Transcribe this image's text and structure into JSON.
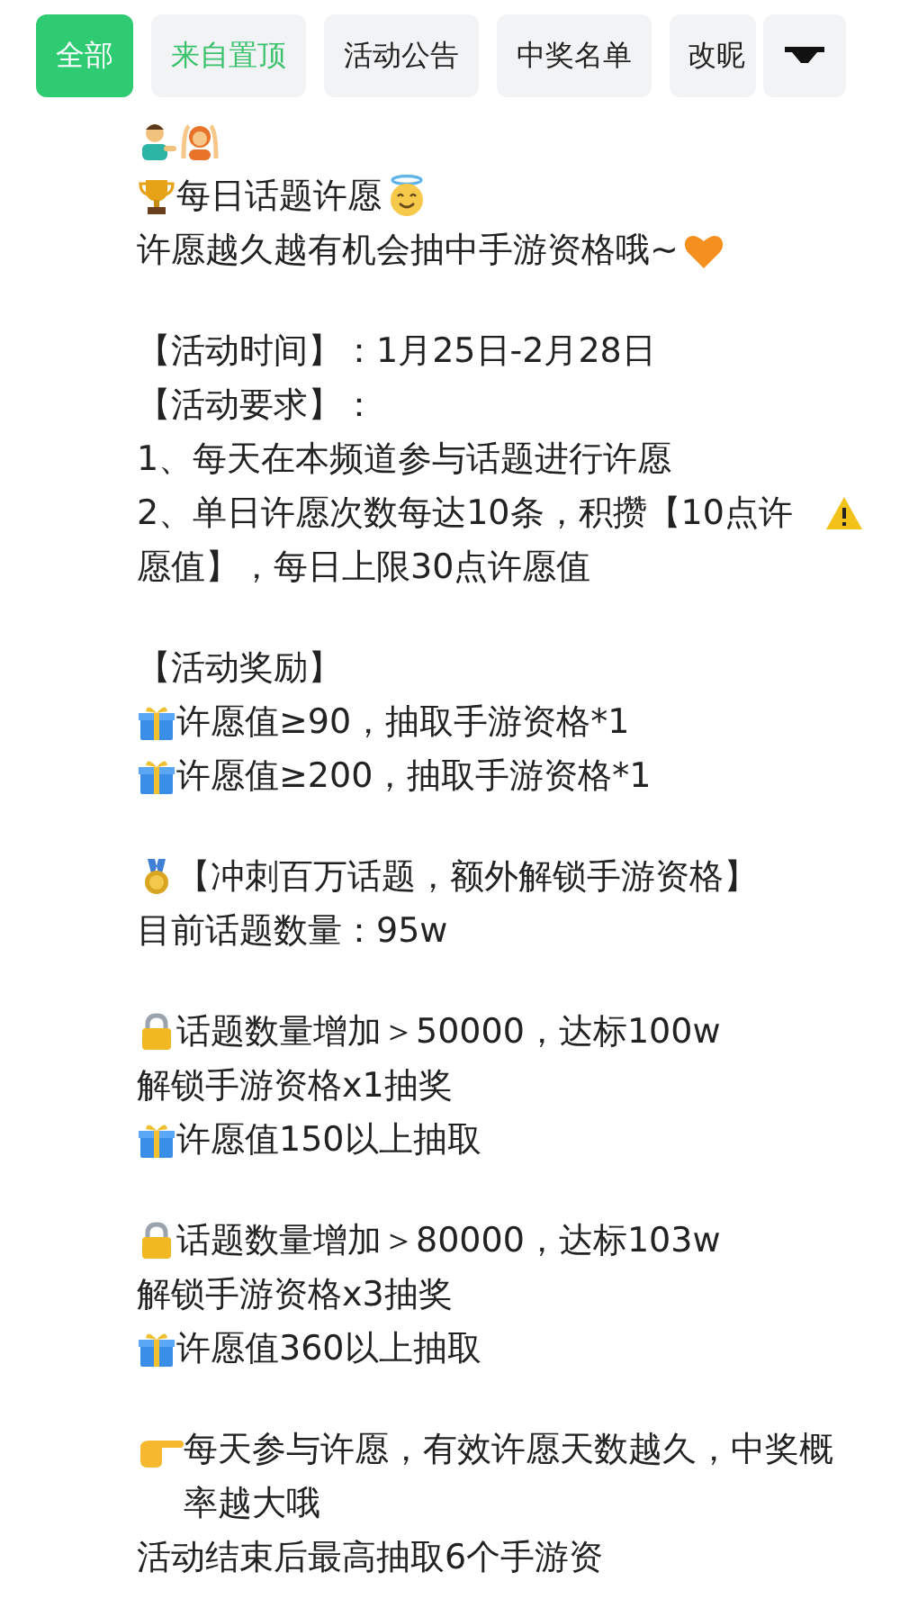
{
  "tabs": [
    {
      "label": "全部",
      "selected": true,
      "kind": "plain"
    },
    {
      "label": "来自置顶",
      "selected": false,
      "kind": "accent"
    },
    {
      "label": "活动公告",
      "selected": false,
      "kind": "plain"
    },
    {
      "label": "中奖名单",
      "selected": false,
      "kind": "plain"
    },
    {
      "label": "改昵",
      "selected": false,
      "kind": "plain"
    }
  ],
  "post": [
    [
      {
        "kind": "icons"
      },
      {
        "kind": "text",
        "text": "每日话题许愿"
      },
      {
        "kind": "text",
        "text": "许愿越久越有机会抽中手游资格哦~"
      }
    ],
    [
      {
        "kind": "text",
        "text": "【活动时间】：1月25日-2月28日"
      },
      {
        "kind": "text",
        "text": "【活动要求】："
      },
      {
        "kind": "text",
        "text": "1、每天在本频道参与话题进行许愿"
      },
      {
        "kind": "text",
        "text": "2、单日许愿次数每达10条，积攒【10点许愿值】，每日上限30点许愿值"
      }
    ],
    [
      {
        "kind": "text",
        "text": "【活动奖励】"
      },
      {
        "kind": "text",
        "text": "许愿值≥90，抽取手游资格*1"
      },
      {
        "kind": "text",
        "text": "许愿值≥200，抽取手游资格*1"
      }
    ],
    [
      {
        "kind": "text",
        "text": "【冲刺百万话题，额外解锁手游资格】"
      },
      {
        "kind": "text",
        "text": "目前话题数量：95w"
      }
    ],
    [
      {
        "kind": "text",
        "text": "话题数量增加＞50000，达标100w"
      },
      {
        "kind": "text",
        "text": "解锁手游资格x1抽奖"
      },
      {
        "kind": "text",
        "text": "许愿值150以上抽取"
      }
    ],
    [
      {
        "kind": "text",
        "text": "话题数量增加＞80000，达标103w"
      },
      {
        "kind": "text",
        "text": "解锁手游资格x3抽奖"
      },
      {
        "kind": "text",
        "text": "许愿值360以上抽取"
      }
    ],
    [
      {
        "kind": "text",
        "text": "每天参与许愿，有效许愿天数越久，中奖概率越大哦"
      },
      {
        "kind": "text",
        "text": "活动结束后最高抽取6个手游资"
      }
    ]
  ]
}
